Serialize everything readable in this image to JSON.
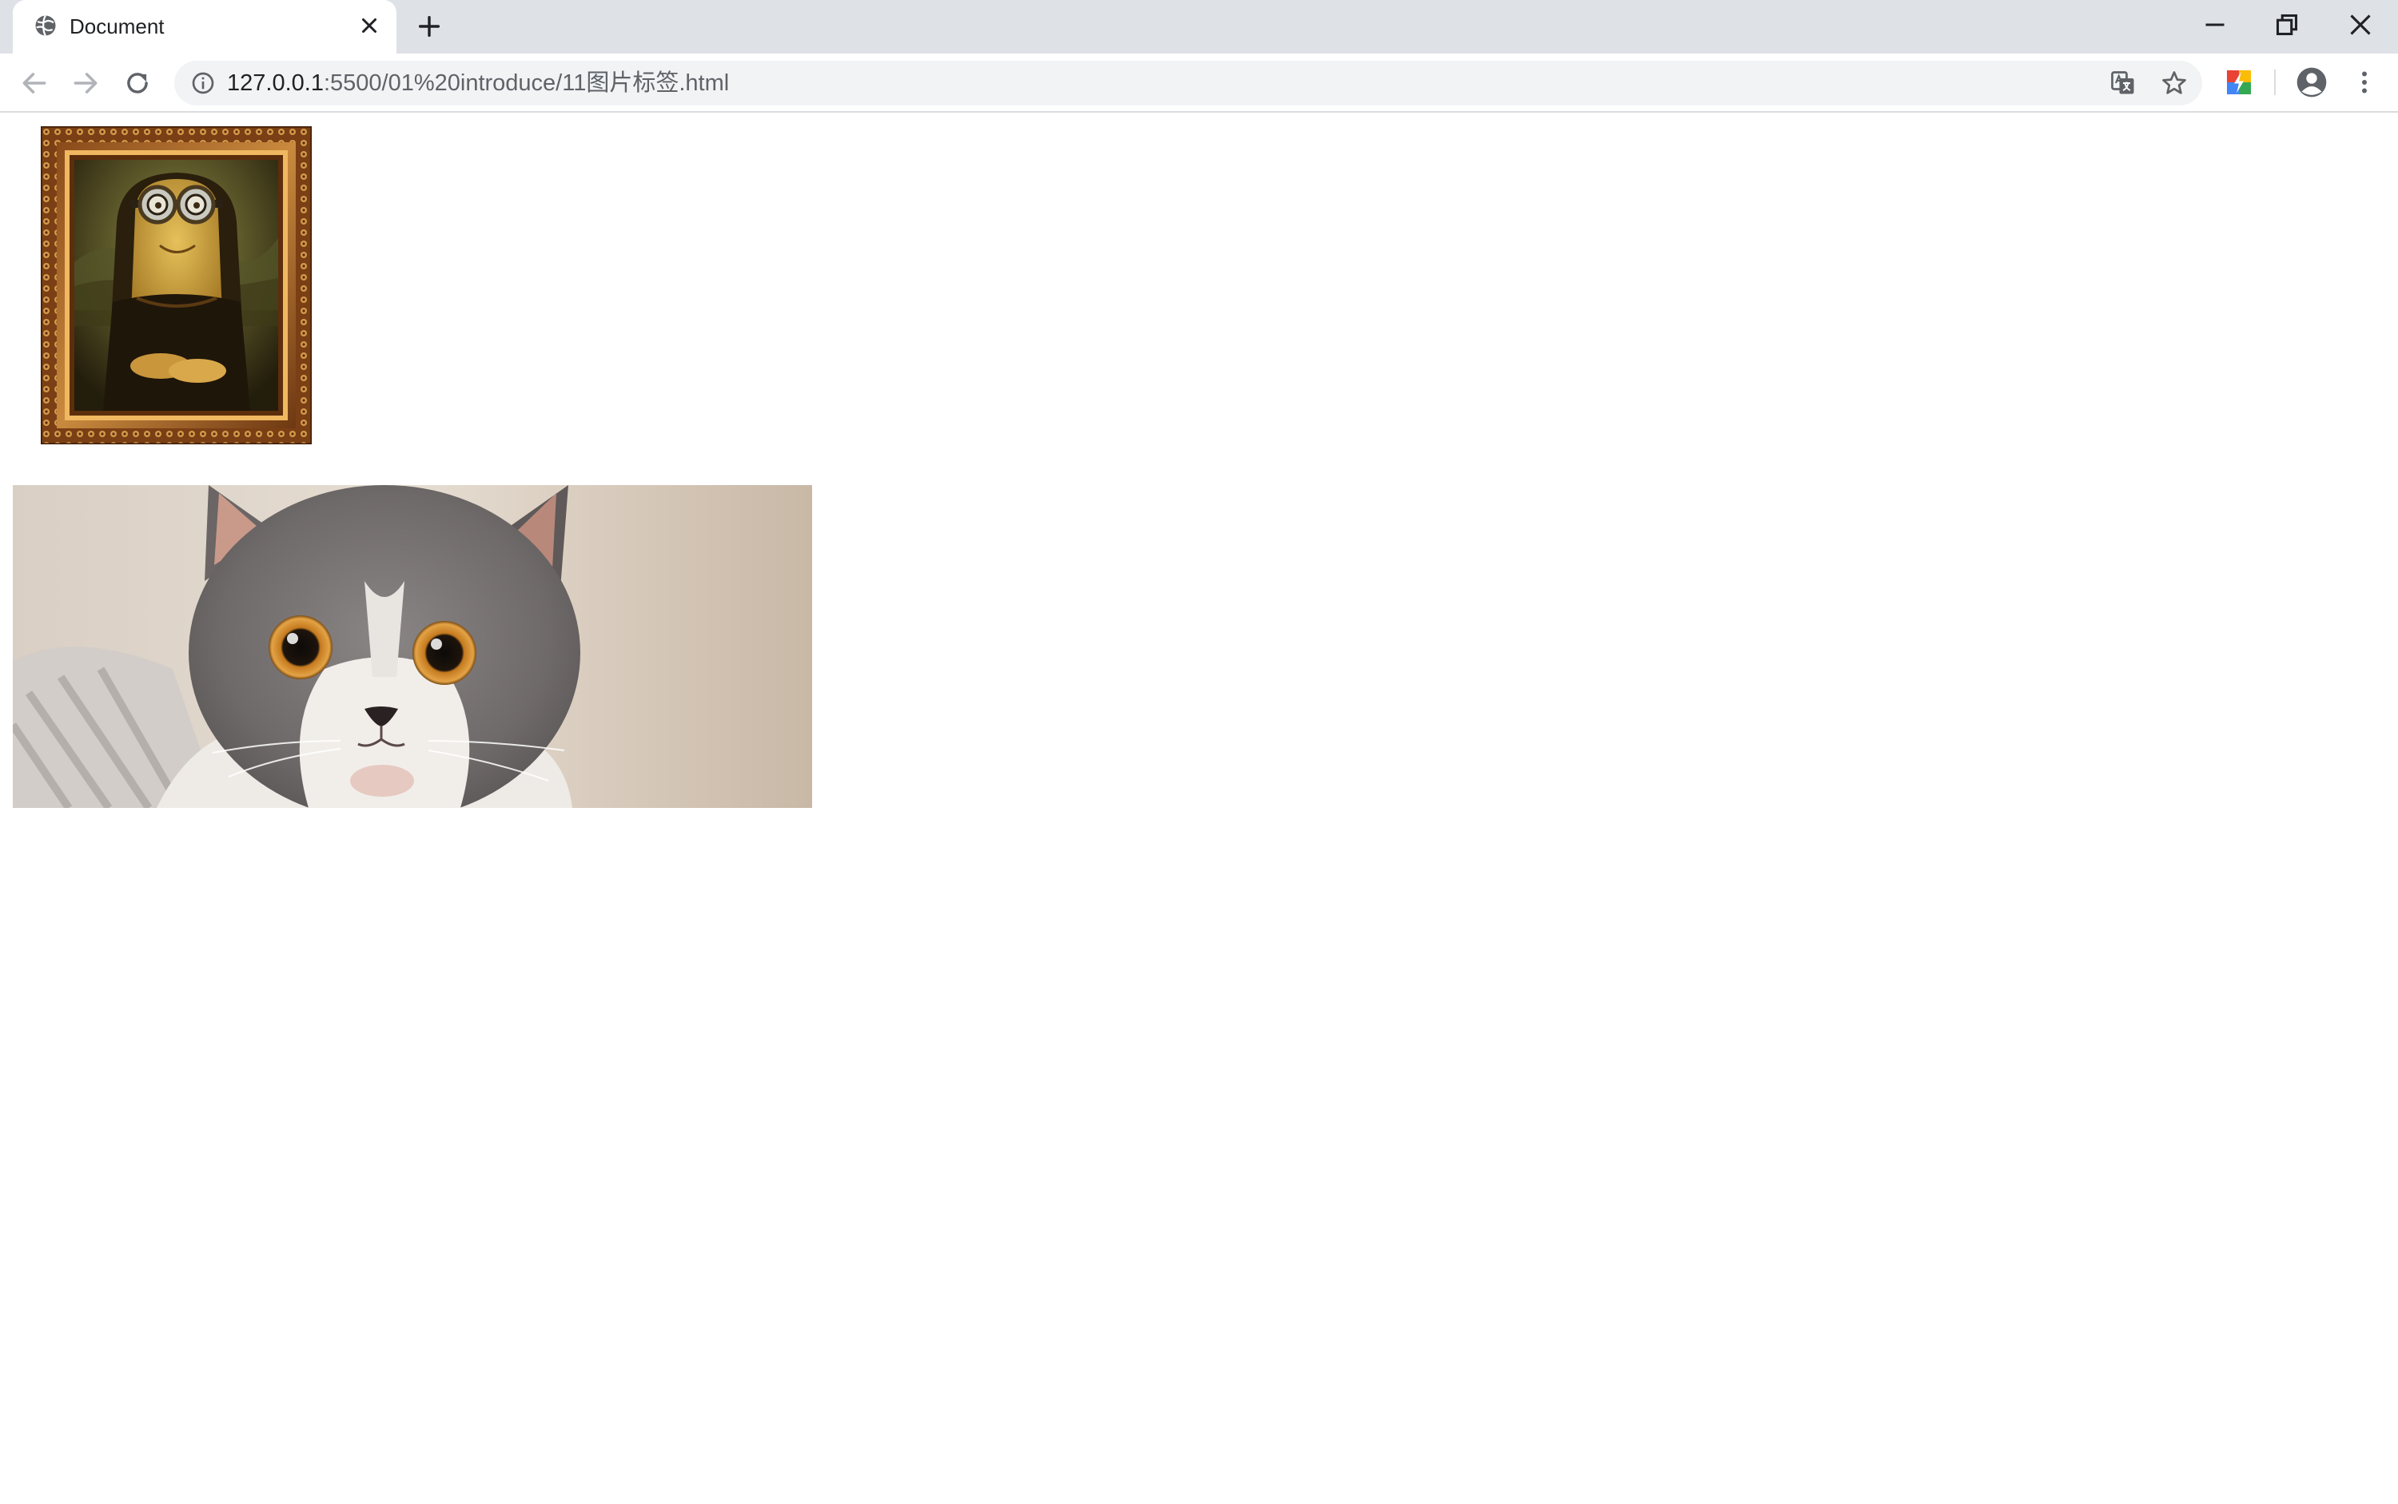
{
  "browser": {
    "tab": {
      "title": "Document",
      "favicon": "globe-icon"
    },
    "window_controls": [
      "minimize-icon",
      "restore-icon",
      "close-icon"
    ],
    "address_bar": {
      "url_host": "127.0.0.1",
      "url_rest": ":5500/01%20introduce/11图片标签.html",
      "security_icon": "info-icon"
    },
    "toolbar_icons": [
      "back-arrow-icon",
      "forward-arrow-icon",
      "reload-icon",
      "translate-icon",
      "star-icon",
      "extension-icon",
      "profile-icon",
      "menu-icon"
    ]
  },
  "page": {
    "images": [
      {
        "name": "mona-lisa-minion-framed-painting"
      },
      {
        "name": "grey-cat-face-photo"
      }
    ]
  },
  "colors": {
    "tabstrip_bg": "#dee1e6",
    "omnibox_bg": "#f1f3f4",
    "page_bg": "#ffffff"
  }
}
